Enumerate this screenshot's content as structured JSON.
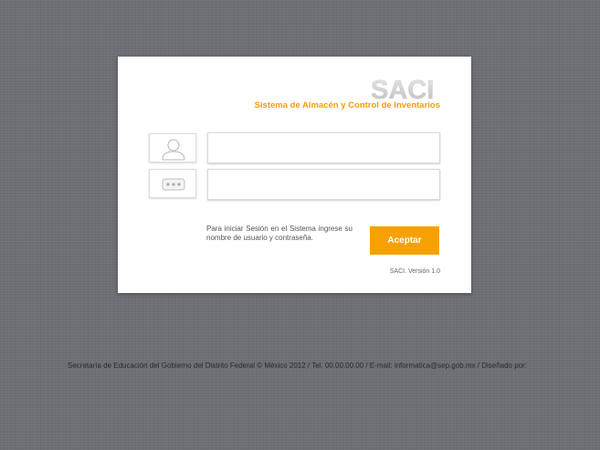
{
  "login": {
    "logo_text": "SACI",
    "subtitle": "Sistema de Almacén y Control de Inventarios",
    "username_value": "",
    "password_value": "",
    "hint": "Para iniciar Sesión en el Sistema ingrese su nombre de usuario y contraseña.",
    "submit_label": "Aceptar",
    "version": "SACI. Versión 1.0"
  },
  "icons": {
    "user": "user-icon",
    "password": "password-dots-icon"
  },
  "footer": {
    "text": "Secretaría de Educación del Gobierno del Distrito Federal © México 2012 / Tel. 00.00.00.00 / E-mail: informatica@sep.gob.mx / Diseñado por:"
  },
  "colors": {
    "background": "#6d6f74",
    "accent": "#f7a100",
    "subtitle": "#f39c12",
    "card": "#ffffff"
  }
}
